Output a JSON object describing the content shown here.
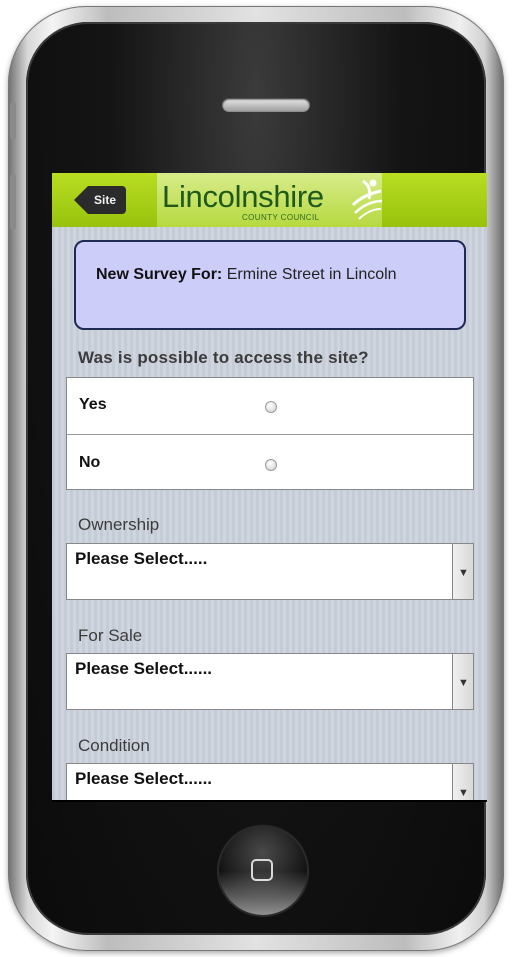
{
  "header": {
    "back_label": "Site",
    "logo_main": "Lincolnshire",
    "logo_sub": "COUNTY COUNCIL"
  },
  "survey": {
    "prefix": "New Survey For:",
    "location": "Ermine Street in Lincoln"
  },
  "access_question": {
    "label": "Was is possible to access the site?",
    "options": [
      {
        "label": "Yes",
        "selected": false
      },
      {
        "label": "No",
        "selected": false
      }
    ]
  },
  "fields": [
    {
      "label": "Ownership",
      "value": "Please Select....."
    },
    {
      "label": "For Sale",
      "value": "Please Select......"
    },
    {
      "label": "Condition",
      "value": "Please Select......"
    }
  ],
  "colors": {
    "header_green": "#a6cf14",
    "logo_text": "#1f5a1b",
    "survey_box_bg": "#cdcdfa"
  },
  "icons": {
    "back": "back-arrow-icon",
    "logo_mark": "leaf-icon",
    "select_arrow": "chevron-down-icon",
    "home": "home-square-icon"
  }
}
